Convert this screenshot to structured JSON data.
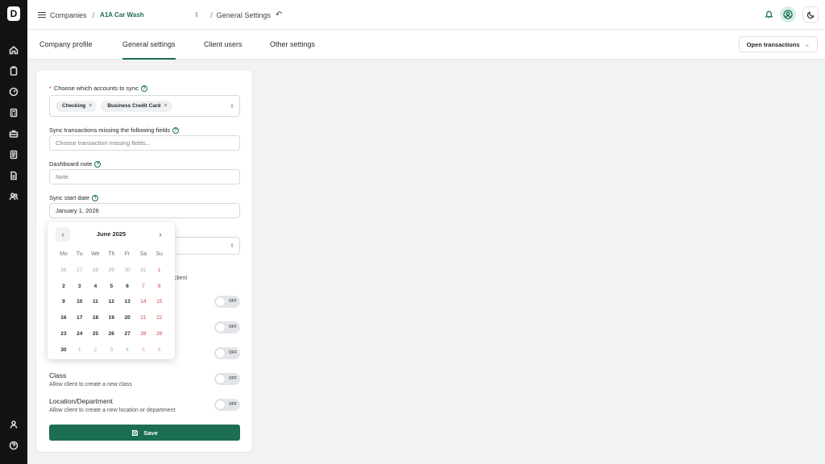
{
  "rail": {
    "logo": "D",
    "icons": [
      "home-icon",
      "clipboard-icon",
      "gauge-icon",
      "calculator-icon",
      "briefcase-icon",
      "ledger-icon",
      "document-icon",
      "users-icon",
      "user-icon",
      "help-icon"
    ]
  },
  "header": {
    "section": "Companies",
    "company": "A1A Car Wash",
    "page": "General Settings"
  },
  "tabs": [
    "Company profile",
    "General settings",
    "Client users",
    "Other settings"
  ],
  "active_tab": "General settings",
  "open_transactions": "Open transactions",
  "form": {
    "accounts_label": "Choose which accounts to sync",
    "accounts_chips": [
      "Checking",
      "Business Credit Card"
    ],
    "missing_label": "Sync transactions missing the following fields",
    "missing_placeholder": "Choose transaction missing fields...",
    "note_label": "Dashboard note",
    "note_placeholder": "Note",
    "start_label": "Sync start date",
    "start_value": "January 1, 2026",
    "partial_client": "client",
    "toggle_off": "OFF",
    "class_title": "Class",
    "class_desc": "Allow client to create a new class",
    "location_title": "Location/Department",
    "location_desc": "Allow client to create a new location or department",
    "save": "Save"
  },
  "calendar": {
    "month": "June 2025",
    "weekdays": [
      "Mo",
      "Tu",
      "We",
      "Th",
      "Fr",
      "Sa",
      "Su"
    ],
    "days": [
      [
        "26",
        "out"
      ],
      [
        "27",
        "out"
      ],
      [
        "28",
        "out"
      ],
      [
        "29",
        "out"
      ],
      [
        "30",
        "out"
      ],
      [
        "31",
        "out"
      ],
      [
        "1",
        "we"
      ],
      [
        "2",
        "in"
      ],
      [
        "3",
        "in"
      ],
      [
        "4",
        "in"
      ],
      [
        "5",
        "in"
      ],
      [
        "6",
        "in"
      ],
      [
        "7",
        "we"
      ],
      [
        "8",
        "we"
      ],
      [
        "9",
        "in"
      ],
      [
        "10",
        "in"
      ],
      [
        "11",
        "in"
      ],
      [
        "12",
        "in"
      ],
      [
        "13",
        "in"
      ],
      [
        "14",
        "we"
      ],
      [
        "15",
        "we"
      ],
      [
        "16",
        "in"
      ],
      [
        "17",
        "in"
      ],
      [
        "18",
        "in"
      ],
      [
        "19",
        "in"
      ],
      [
        "20",
        "in"
      ],
      [
        "21",
        "we"
      ],
      [
        "22",
        "we"
      ],
      [
        "23",
        "in"
      ],
      [
        "24",
        "in"
      ],
      [
        "25",
        "in"
      ],
      [
        "26",
        "in"
      ],
      [
        "27",
        "in"
      ],
      [
        "28",
        "we"
      ],
      [
        "29",
        "we"
      ],
      [
        "30",
        "in"
      ],
      [
        "1",
        "out"
      ],
      [
        "2",
        "out"
      ],
      [
        "3",
        "out"
      ],
      [
        "4",
        "out"
      ],
      [
        "5",
        "out we"
      ],
      [
        "6",
        "out we"
      ]
    ]
  },
  "colors": {
    "brand": "#1b6e51",
    "weekend": "#d04343",
    "sidebar": "#111315"
  }
}
